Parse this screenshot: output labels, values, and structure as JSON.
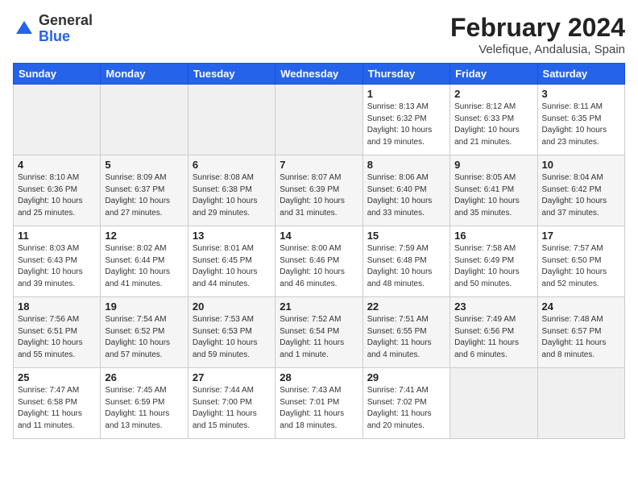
{
  "header": {
    "logo_general": "General",
    "logo_blue": "Blue",
    "month_year": "February 2024",
    "location": "Velefique, Andalusia, Spain"
  },
  "days_of_week": [
    "Sunday",
    "Monday",
    "Tuesday",
    "Wednesday",
    "Thursday",
    "Friday",
    "Saturday"
  ],
  "weeks": [
    [
      {
        "day": "",
        "info": ""
      },
      {
        "day": "",
        "info": ""
      },
      {
        "day": "",
        "info": ""
      },
      {
        "day": "",
        "info": ""
      },
      {
        "day": "1",
        "info": "Sunrise: 8:13 AM\nSunset: 6:32 PM\nDaylight: 10 hours\nand 19 minutes."
      },
      {
        "day": "2",
        "info": "Sunrise: 8:12 AM\nSunset: 6:33 PM\nDaylight: 10 hours\nand 21 minutes."
      },
      {
        "day": "3",
        "info": "Sunrise: 8:11 AM\nSunset: 6:35 PM\nDaylight: 10 hours\nand 23 minutes."
      }
    ],
    [
      {
        "day": "4",
        "info": "Sunrise: 8:10 AM\nSunset: 6:36 PM\nDaylight: 10 hours\nand 25 minutes."
      },
      {
        "day": "5",
        "info": "Sunrise: 8:09 AM\nSunset: 6:37 PM\nDaylight: 10 hours\nand 27 minutes."
      },
      {
        "day": "6",
        "info": "Sunrise: 8:08 AM\nSunset: 6:38 PM\nDaylight: 10 hours\nand 29 minutes."
      },
      {
        "day": "7",
        "info": "Sunrise: 8:07 AM\nSunset: 6:39 PM\nDaylight: 10 hours\nand 31 minutes."
      },
      {
        "day": "8",
        "info": "Sunrise: 8:06 AM\nSunset: 6:40 PM\nDaylight: 10 hours\nand 33 minutes."
      },
      {
        "day": "9",
        "info": "Sunrise: 8:05 AM\nSunset: 6:41 PM\nDaylight: 10 hours\nand 35 minutes."
      },
      {
        "day": "10",
        "info": "Sunrise: 8:04 AM\nSunset: 6:42 PM\nDaylight: 10 hours\nand 37 minutes."
      }
    ],
    [
      {
        "day": "11",
        "info": "Sunrise: 8:03 AM\nSunset: 6:43 PM\nDaylight: 10 hours\nand 39 minutes."
      },
      {
        "day": "12",
        "info": "Sunrise: 8:02 AM\nSunset: 6:44 PM\nDaylight: 10 hours\nand 41 minutes."
      },
      {
        "day": "13",
        "info": "Sunrise: 8:01 AM\nSunset: 6:45 PM\nDaylight: 10 hours\nand 44 minutes."
      },
      {
        "day": "14",
        "info": "Sunrise: 8:00 AM\nSunset: 6:46 PM\nDaylight: 10 hours\nand 46 minutes."
      },
      {
        "day": "15",
        "info": "Sunrise: 7:59 AM\nSunset: 6:48 PM\nDaylight: 10 hours\nand 48 minutes."
      },
      {
        "day": "16",
        "info": "Sunrise: 7:58 AM\nSunset: 6:49 PM\nDaylight: 10 hours\nand 50 minutes."
      },
      {
        "day": "17",
        "info": "Sunrise: 7:57 AM\nSunset: 6:50 PM\nDaylight: 10 hours\nand 52 minutes."
      }
    ],
    [
      {
        "day": "18",
        "info": "Sunrise: 7:56 AM\nSunset: 6:51 PM\nDaylight: 10 hours\nand 55 minutes."
      },
      {
        "day": "19",
        "info": "Sunrise: 7:54 AM\nSunset: 6:52 PM\nDaylight: 10 hours\nand 57 minutes."
      },
      {
        "day": "20",
        "info": "Sunrise: 7:53 AM\nSunset: 6:53 PM\nDaylight: 10 hours\nand 59 minutes."
      },
      {
        "day": "21",
        "info": "Sunrise: 7:52 AM\nSunset: 6:54 PM\nDaylight: 11 hours\nand 1 minute."
      },
      {
        "day": "22",
        "info": "Sunrise: 7:51 AM\nSunset: 6:55 PM\nDaylight: 11 hours\nand 4 minutes."
      },
      {
        "day": "23",
        "info": "Sunrise: 7:49 AM\nSunset: 6:56 PM\nDaylight: 11 hours\nand 6 minutes."
      },
      {
        "day": "24",
        "info": "Sunrise: 7:48 AM\nSunset: 6:57 PM\nDaylight: 11 hours\nand 8 minutes."
      }
    ],
    [
      {
        "day": "25",
        "info": "Sunrise: 7:47 AM\nSunset: 6:58 PM\nDaylight: 11 hours\nand 11 minutes."
      },
      {
        "day": "26",
        "info": "Sunrise: 7:45 AM\nSunset: 6:59 PM\nDaylight: 11 hours\nand 13 minutes."
      },
      {
        "day": "27",
        "info": "Sunrise: 7:44 AM\nSunset: 7:00 PM\nDaylight: 11 hours\nand 15 minutes."
      },
      {
        "day": "28",
        "info": "Sunrise: 7:43 AM\nSunset: 7:01 PM\nDaylight: 11 hours\nand 18 minutes."
      },
      {
        "day": "29",
        "info": "Sunrise: 7:41 AM\nSunset: 7:02 PM\nDaylight: 11 hours\nand 20 minutes."
      },
      {
        "day": "",
        "info": ""
      },
      {
        "day": "",
        "info": ""
      }
    ]
  ]
}
